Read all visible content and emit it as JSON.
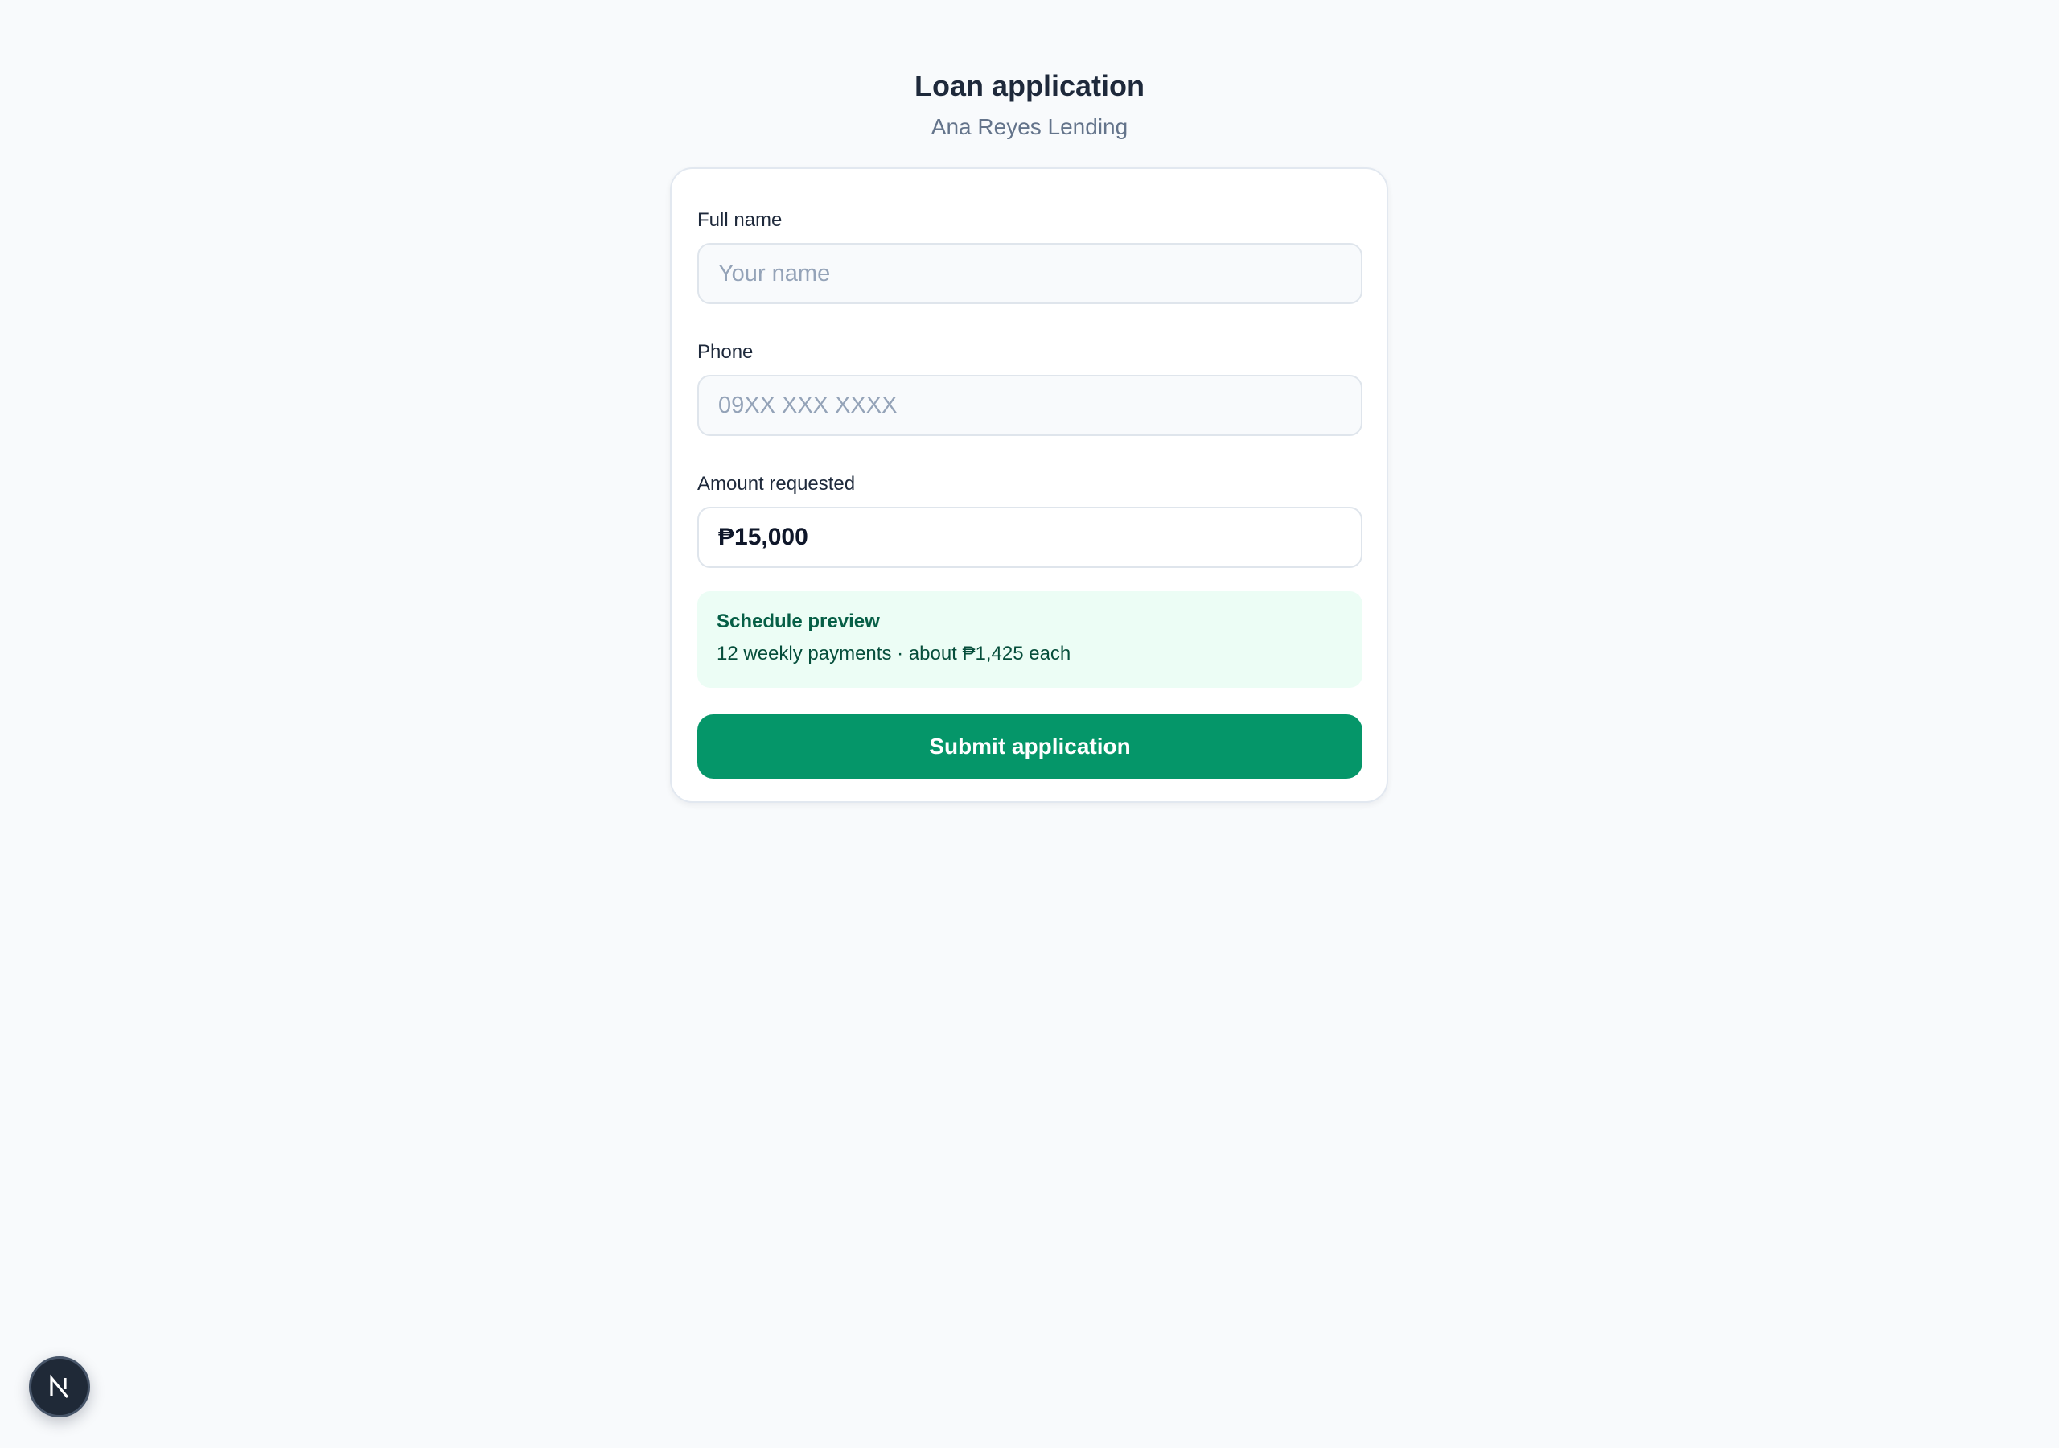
{
  "header": {
    "title": "Loan application",
    "subtitle": "Ana Reyes Lending"
  },
  "form": {
    "full_name": {
      "label": "Full name",
      "placeholder": "Your name",
      "value": ""
    },
    "phone": {
      "label": "Phone",
      "placeholder": "09XX XXX XXXX",
      "value": ""
    },
    "amount": {
      "label": "Amount requested",
      "value": "₱15,000"
    }
  },
  "schedule_preview": {
    "title": "Schedule preview",
    "text": "12 weekly payments · about ₱1,425 each"
  },
  "submit_label": "Submit application",
  "dev_badge": {
    "icon": "nextjs-logo-icon",
    "letter": "N"
  },
  "colors": {
    "accent": "#059669",
    "preview_bg": "#ecfdf5",
    "preview_title": "#065f46",
    "page_bg": "#f8fafc"
  }
}
